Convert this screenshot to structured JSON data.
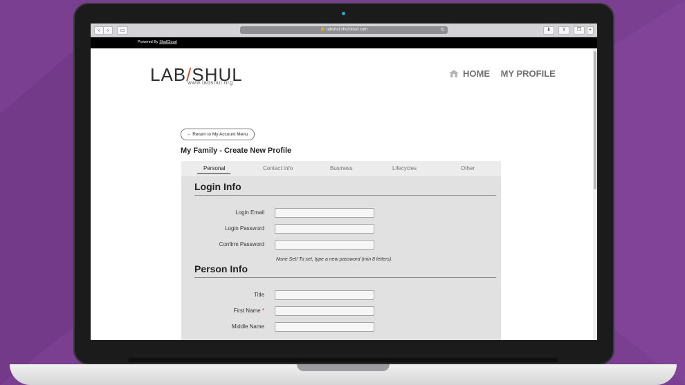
{
  "browser": {
    "url": "labshul.shulcloud.com",
    "back_icon": "chevron-left-icon",
    "forward_icon": "chevron-right-icon",
    "sidebar_icon": "sidebar-icon",
    "reload_icon": "reload-icon"
  },
  "powered_by": {
    "prefix": "Powered By",
    "link": "ShulCloud"
  },
  "site": {
    "logo_left": "LAB",
    "logo_slash": "/",
    "logo_right": "SHUL",
    "logo_url": "www.labshul.org",
    "nav": {
      "home": "HOME",
      "profile": "MY PROFILE"
    }
  },
  "page": {
    "return_button": "← Return to My Account Menu",
    "heading": "My Family - Create New Profile",
    "tabs": [
      "Personal",
      "Contact Info",
      "Business",
      "Lifecycles",
      "Other"
    ],
    "active_tab": "Personal"
  },
  "login_info": {
    "title": "Login Info",
    "email_label": "Login Email",
    "email_value": "",
    "password_label": "Login Password",
    "password_value": "",
    "confirm_label": "Confirm Password",
    "confirm_value": "",
    "note": "None Set! To set, type a new password (min 8 letters)."
  },
  "person_info": {
    "title": "Person Info",
    "title_label": "Title",
    "title_value": "",
    "first_name_label": "First Name",
    "first_name_required": "*",
    "first_name_value": "",
    "middle_name_label": "Middle Name",
    "middle_name_value": ""
  },
  "colors": {
    "brand_accent": "#d94b2b",
    "background": "#7b3f92"
  }
}
